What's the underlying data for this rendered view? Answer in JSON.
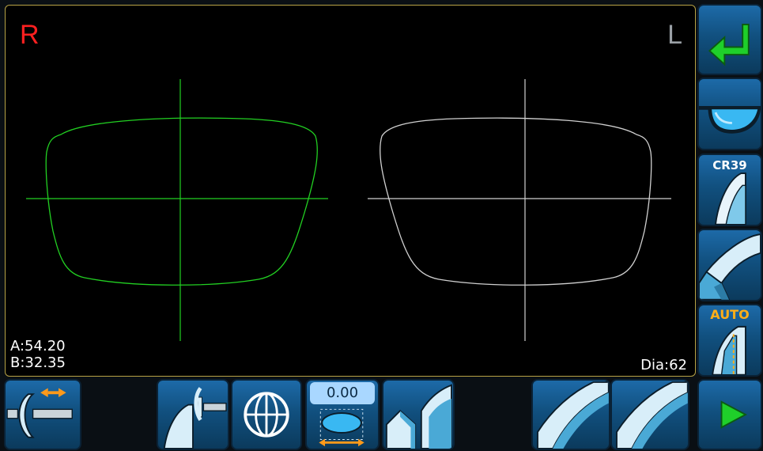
{
  "display": {
    "right_label": "R",
    "left_label": "L",
    "a_value": "A:54.20",
    "b_value": "B:32.35",
    "dia_value": "Dia:62"
  },
  "toolbar": {
    "offset_value": "0.00",
    "material_label": "CR39",
    "auto_label": "AUTO"
  },
  "colors": {
    "right_shape": "#22d022",
    "left_shape": "#d0d0d0",
    "accent_green": "#1fcf2a",
    "button_blue": "#1d6aa8",
    "frame_border": "#b7a245"
  },
  "icons": {
    "enter": "return-arrow-icon",
    "frame": "glasses-icon",
    "material": "lens-material-icon",
    "bevel": "bevel-edge-icon",
    "auto_bevel": "auto-bevel-icon",
    "clamp": "lens-clamp-icon",
    "pin_position": "drill-position-icon",
    "centering": "centering-target-icon",
    "size_offset": "size-offset-icon",
    "polish": "polish-icon",
    "wheel_1": "grinding-wheel-icon",
    "wheel_2": "grinding-wheel-icon",
    "start": "play-icon"
  }
}
